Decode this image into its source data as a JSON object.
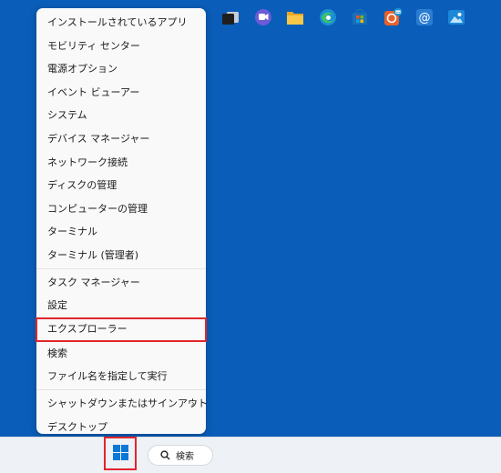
{
  "menu": {
    "items": [
      {
        "label": "インストールされているアプリ"
      },
      {
        "label": "モビリティ センター"
      },
      {
        "label": "電源オプション"
      },
      {
        "label": "イベント ビューアー"
      },
      {
        "label": "システム"
      },
      {
        "label": "デバイス マネージャー"
      },
      {
        "label": "ネットワーク接続"
      },
      {
        "label": "ディスクの管理"
      },
      {
        "label": "コンピューターの管理"
      },
      {
        "label": "ターミナル"
      },
      {
        "label": "ターミナル (管理者)"
      },
      {
        "label": "タスク マネージャー"
      },
      {
        "label": "設定"
      },
      {
        "label": "エクスプローラー"
      },
      {
        "label": "検索"
      },
      {
        "label": "ファイル名を指定して実行"
      },
      {
        "label": "シャットダウンまたはサインアウト"
      },
      {
        "label": "デスクトップ"
      }
    ]
  },
  "taskbar": {
    "search_label": "検索",
    "icons": [
      "windows-start-icon",
      "search-icon",
      "task-view-icon",
      "chat-icon",
      "file-explorer-icon",
      "edge-icon",
      "microsoft-store-icon",
      "office-icon",
      "mail-icon",
      "photos-icon"
    ]
  },
  "colors": {
    "desktop": "#0a5db8",
    "highlight_border": "#e0262c",
    "accent": "#0b78d6"
  }
}
